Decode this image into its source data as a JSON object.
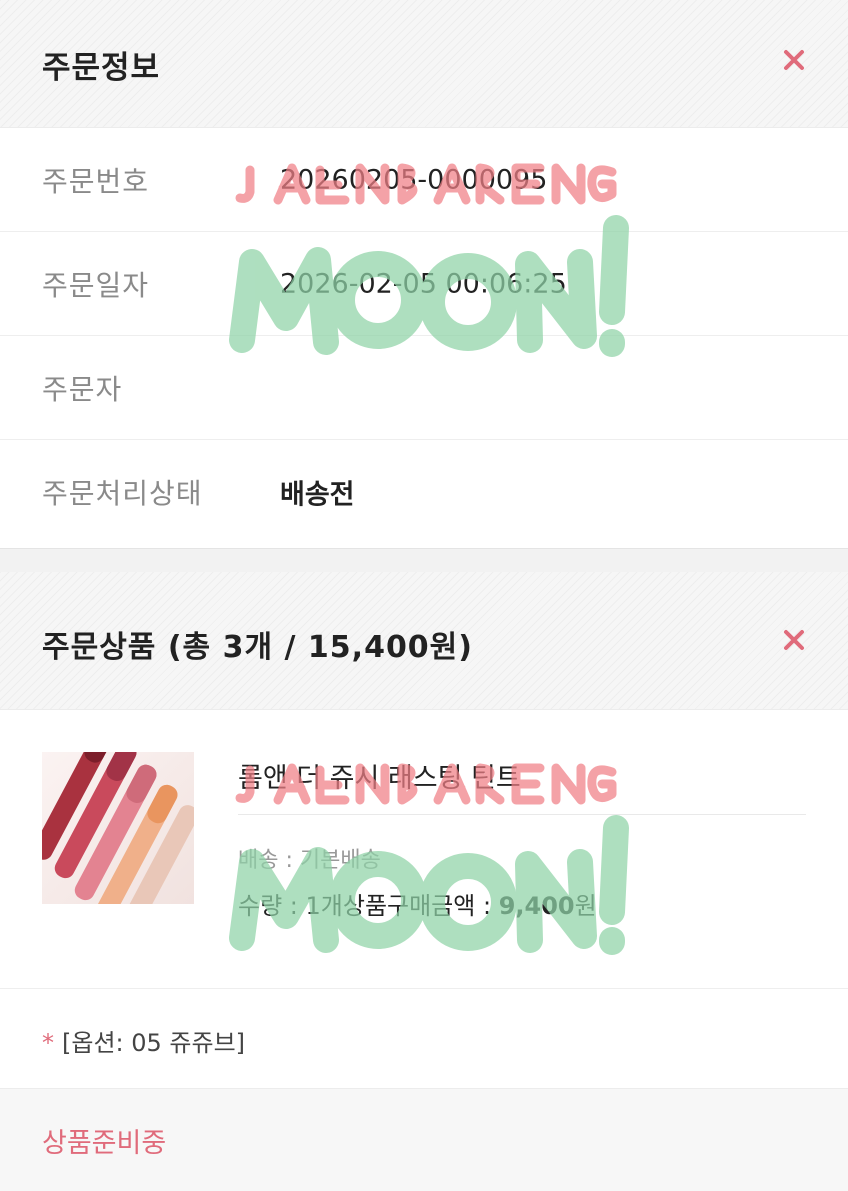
{
  "order_info": {
    "title": "주문정보",
    "rows": [
      {
        "label": "주문번호",
        "value": "20260205-0000095"
      },
      {
        "label": "주문일자",
        "value": "2026-02-05 00:06:25"
      },
      {
        "label": "주문자",
        "value": ""
      },
      {
        "label": "주문처리상태",
        "value": "배송전"
      }
    ]
  },
  "order_products": {
    "title": "주문상품 (총 3개 / 15,400원)",
    "product": {
      "name": "롬앤 더 쥬시 래스팅 틴트",
      "shipping": "배송 : 기본배송",
      "qty_prefix": "수량 : 1개",
      "amount_label": "상품구매금액 : ",
      "amount": "9,400",
      "amount_unit": "원"
    },
    "option": {
      "star": "*",
      "text": "[옵션: 05 쥬쥬브]"
    },
    "status": "상품준비중"
  },
  "icons": {
    "close": "close-icon",
    "thumbnail": "lip-tint-product-image"
  },
  "colors": {
    "accent_pink": "#e06b7b",
    "watermark_green": "#8fd3a7",
    "watermark_pink": "#f07f86"
  }
}
